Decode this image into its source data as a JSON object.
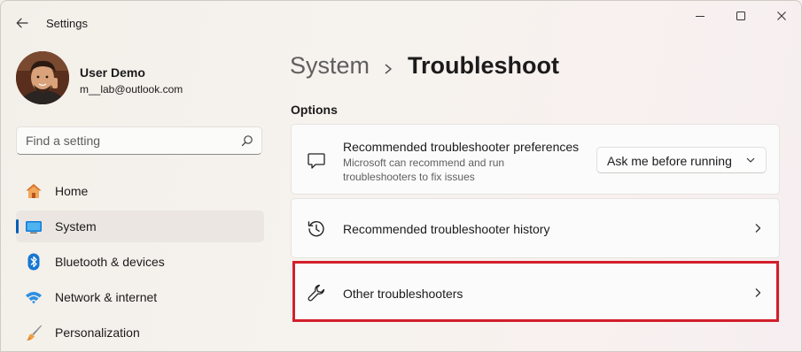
{
  "window": {
    "title": "Settings"
  },
  "profile": {
    "name": "User Demo",
    "email": "m__lab@outlook.com"
  },
  "search": {
    "placeholder": "Find a setting"
  },
  "nav": [
    {
      "label": "Home",
      "icon": "home-icon",
      "selected": false
    },
    {
      "label": "System",
      "icon": "system-icon",
      "selected": true
    },
    {
      "label": "Bluetooth & devices",
      "icon": "bluetooth-icon",
      "selected": false
    },
    {
      "label": "Network & internet",
      "icon": "wifi-icon",
      "selected": false
    },
    {
      "label": "Personalization",
      "icon": "brush-icon",
      "selected": false
    }
  ],
  "breadcrumb": {
    "parent": "System",
    "current": "Troubleshoot"
  },
  "options": {
    "label": "Options",
    "preferences": {
      "title": "Recommended troubleshooter preferences",
      "description": "Microsoft can recommend and run troubleshooters to fix issues",
      "dropdown_value": "Ask me before running"
    },
    "history": {
      "title": "Recommended troubleshooter history"
    },
    "other": {
      "title": "Other troubleshooters",
      "highlighted": true
    }
  },
  "colors": {
    "accent": "#005fb8",
    "highlight": "#d21f2a"
  }
}
